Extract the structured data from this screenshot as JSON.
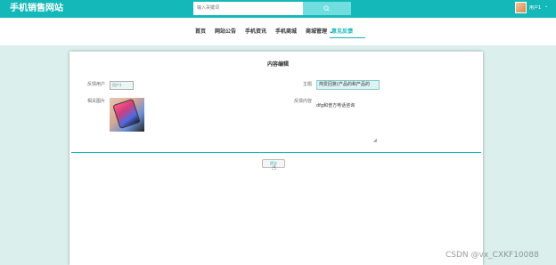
{
  "header": {
    "site_title": "手机销售网站",
    "search_placeholder": "输入关键词",
    "search_icon": "search-icon",
    "user_name": "用户1",
    "user_chevron": "⌄"
  },
  "nav": {
    "items": [
      "首页",
      "网站公告",
      "手机资讯",
      "手机商城",
      "商城管理 ⌄",
      "意见反馈"
    ],
    "active_index": 5
  },
  "form": {
    "title": "内容编辑",
    "user_label": "反馈用户",
    "user_value": "用户1",
    "title_label": "主题",
    "title_value": "简爱回复(产品的和产品的",
    "image_label": "相关图片",
    "content_label": "反馈内容",
    "content_value": "dfg和普方电话咨询",
    "submit_label": "提交"
  },
  "watermark": "CSDN @vx_CXKF10088",
  "colors": {
    "accent": "#15b8b8",
    "background": "#dbefed"
  }
}
